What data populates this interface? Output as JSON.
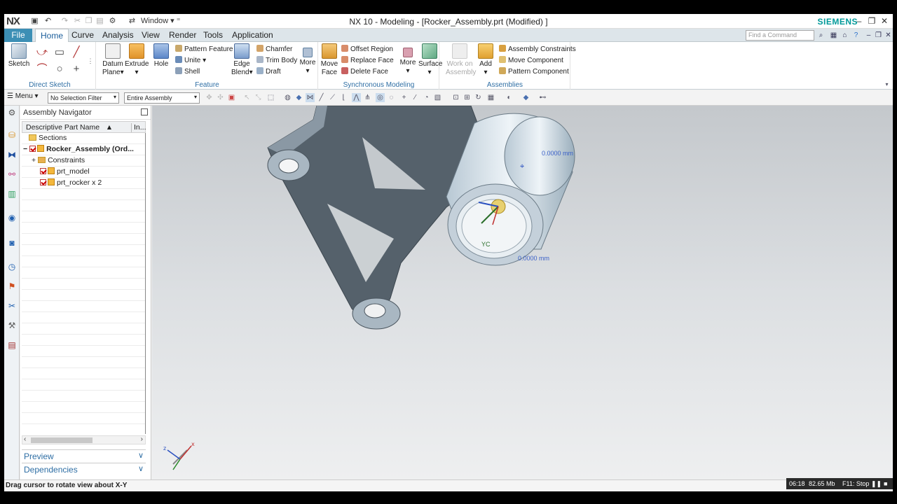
{
  "title_bar": {
    "logo": "NX",
    "window_menu": "Window",
    "title": "NX 10 - Modeling - [Rocker_Assembly.prt (Modified) ]",
    "brand": "SIEMENS",
    "brand_color": "#009999"
  },
  "tabs": {
    "file": "File",
    "items": [
      "Home",
      "Curve",
      "Analysis",
      "View",
      "Render",
      "Tools",
      "Application"
    ],
    "active": "Home",
    "find_placeholder": "Find a Command"
  },
  "ribbon": {
    "direct_sketch": {
      "label": "Direct Sketch",
      "sketch": "Sketch"
    },
    "feature": {
      "label": "Feature",
      "datum_plane_1": "Datum",
      "datum_plane_2": "Plane",
      "extrude": "Extrude",
      "hole": "Hole",
      "pattern_feature": "Pattern Feature",
      "unite": "Unite",
      "shell": "Shell",
      "edge_blend_1": "Edge",
      "edge_blend_2": "Blend",
      "chamfer": "Chamfer",
      "trim_body": "Trim Body",
      "draft": "Draft",
      "more": "More"
    },
    "synchronous": {
      "label": "Synchronous Modeling",
      "move_face_1": "Move",
      "move_face_2": "Face",
      "offset_region": "Offset Region",
      "replace_face": "Replace Face",
      "delete_face": "Delete Face",
      "more": "More",
      "surface": "Surface"
    },
    "assemblies": {
      "label": "Assemblies",
      "work_on_1": "Work on",
      "work_on_2": "Assembly",
      "add": "Add",
      "assembly_constraints": "Assembly Constraints",
      "move_component": "Move Component",
      "pattern_component": "Pattern Component"
    }
  },
  "toolbar": {
    "menu": "Menu",
    "selection_filter": "No Selection Filter",
    "scope": "Entire Assembly"
  },
  "navigator": {
    "title": "Assembly Navigator",
    "col_name": "Descriptive Part Name",
    "col_info": "In...",
    "rows": [
      {
        "label": "Sections"
      },
      {
        "label": "Rocker_Assembly (Ord..."
      },
      {
        "label": "Constraints"
      },
      {
        "label": "prt_model"
      },
      {
        "label": "prt_rocker x 2"
      }
    ],
    "preview": "Preview",
    "dependencies": "Dependencies"
  },
  "viewport": {
    "dim_label_1": "0.0000 mm",
    "dim_label_2": "0.0000 mm",
    "csys_label": "YC"
  },
  "status": {
    "message": "Drag cursor to rotate view about X-Y"
  },
  "recorder": {
    "time": "06:18",
    "memory": "82.65 Mb",
    "stop": "F11: Stop"
  }
}
